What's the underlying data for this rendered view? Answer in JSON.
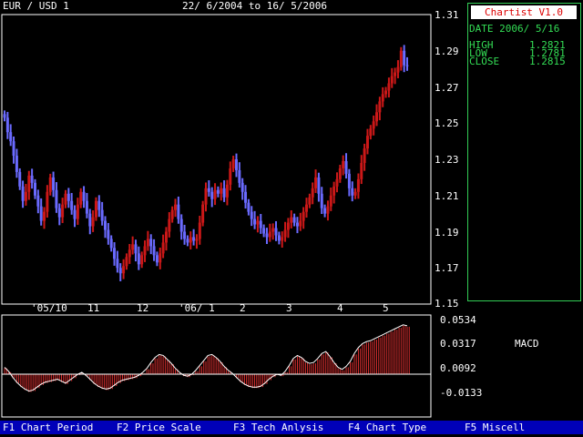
{
  "header": {
    "pair": "EUR / USD 1",
    "date_range": "22/ 6/2004 to 16/ 5/2006"
  },
  "info_panel": {
    "app_name": "Chartist V1.0",
    "date_label": "DATE 2006/ 5/16",
    "high_label": "HIGH",
    "high_value": "1.2821",
    "low_label": "LOW",
    "low_value": "1.2781",
    "close_label": "CLOSE",
    "close_value": "1.2815"
  },
  "menu": [
    {
      "label": "F1 Chart Period"
    },
    {
      "label": "F2 Price Scale"
    },
    {
      "label": "F3 Tech Anlysis"
    },
    {
      "label": "F4 Chart Type"
    },
    {
      "label": "F5 Miscell"
    }
  ],
  "colors": {
    "up": "#cc1818",
    "down": "#6a6aff",
    "macd_bar": "#dd3030",
    "frame": "#ffffff",
    "panel_border": "#33cc55",
    "panel_text": "#33dd55",
    "menu_bg": "#0000b8"
  },
  "chart_data": [
    {
      "type": "candlestick",
      "title": "",
      "y_ticks": [
        "1.31",
        "1.29",
        "1.27",
        "1.25",
        "1.23",
        "1.21",
        "1.19",
        "1.17",
        "1.15"
      ],
      "ylim": [
        1.15,
        1.31
      ],
      "x_tick_labels": [
        "'05/10",
        "11",
        "12",
        "'06/ 1",
        "2",
        "3",
        "4",
        "5"
      ],
      "close_approx": [
        1.253,
        1.245,
        1.24,
        1.232,
        1.223,
        1.215,
        1.207,
        1.212,
        1.221,
        1.217,
        1.21,
        1.204,
        1.196,
        1.201,
        1.212,
        1.22,
        1.213,
        1.203,
        1.198,
        1.205,
        1.211,
        1.207,
        1.202,
        1.197,
        1.205,
        1.212,
        1.207,
        1.2,
        1.193,
        1.198,
        1.207,
        1.202,
        1.196,
        1.191,
        1.186,
        1.181,
        1.175,
        1.17,
        1.167,
        1.171,
        1.176,
        1.18,
        1.183,
        1.178,
        1.172,
        1.177,
        1.182,
        1.186,
        1.182,
        1.177,
        1.173,
        1.178,
        1.184,
        1.19,
        1.197,
        1.202,
        1.205,
        1.197,
        1.19,
        1.186,
        1.184,
        1.187,
        1.185,
        1.186,
        1.195,
        1.205,
        1.214,
        1.212,
        1.208,
        1.213,
        1.211,
        1.214,
        1.209,
        1.216,
        1.225,
        1.23,
        1.224,
        1.217,
        1.212,
        1.206,
        1.201,
        1.197,
        1.194,
        1.196,
        1.192,
        1.189,
        1.187,
        1.19,
        1.192,
        1.188,
        1.185,
        1.187,
        1.191,
        1.195,
        1.198,
        1.195,
        1.193,
        1.196,
        1.201,
        1.205,
        1.209,
        1.214,
        1.22,
        1.211,
        1.203,
        1.2,
        1.204,
        1.21,
        1.215,
        1.219,
        1.225,
        1.229,
        1.222,
        1.214,
        1.21,
        1.212,
        1.219,
        1.228,
        1.236,
        1.243,
        1.247,
        1.251,
        1.256,
        1.262,
        1.266,
        1.268,
        1.272,
        1.276,
        1.278,
        1.281,
        1.29,
        1.282,
        1.2815
      ]
    },
    {
      "type": "bar",
      "title": "MACD",
      "y_ticks": [
        "0.0534",
        "0.0317",
        "0.0092",
        "-0.0133"
      ],
      "ylim": [
        -0.0133,
        0.0534
      ],
      "values_approx": [
        0.006,
        0.002,
        -0.004,
        -0.009,
        -0.013,
        -0.016,
        -0.018,
        -0.017,
        -0.014,
        -0.011,
        -0.009,
        -0.008,
        -0.007,
        -0.006,
        -0.008,
        -0.01,
        -0.007,
        -0.004,
        -0.001,
        0.001,
        -0.002,
        -0.006,
        -0.01,
        -0.013,
        -0.015,
        -0.016,
        -0.015,
        -0.012,
        -0.009,
        -0.007,
        -0.006,
        -0.005,
        -0.004,
        -0.002,
        0.001,
        0.005,
        0.011,
        0.016,
        0.019,
        0.018,
        0.014,
        0.01,
        0.005,
        0.001,
        -0.002,
        -0.003,
        -0.001,
        0.003,
        0.008,
        0.013,
        0.018,
        0.019,
        0.016,
        0.012,
        0.007,
        0.003,
        0.0,
        -0.004,
        -0.008,
        -0.011,
        -0.013,
        -0.014,
        -0.014,
        -0.013,
        -0.01,
        -0.006,
        -0.003,
        -0.001,
        -0.002,
        0.002,
        0.008,
        0.015,
        0.018,
        0.016,
        0.012,
        0.01,
        0.011,
        0.015,
        0.02,
        0.022,
        0.017,
        0.011,
        0.006,
        0.004,
        0.007,
        0.012,
        0.02,
        0.026,
        0.03,
        0.032,
        0.033,
        0.035,
        0.037,
        0.039,
        0.041,
        0.043,
        0.045,
        0.047,
        0.049,
        0.048
      ]
    }
  ]
}
